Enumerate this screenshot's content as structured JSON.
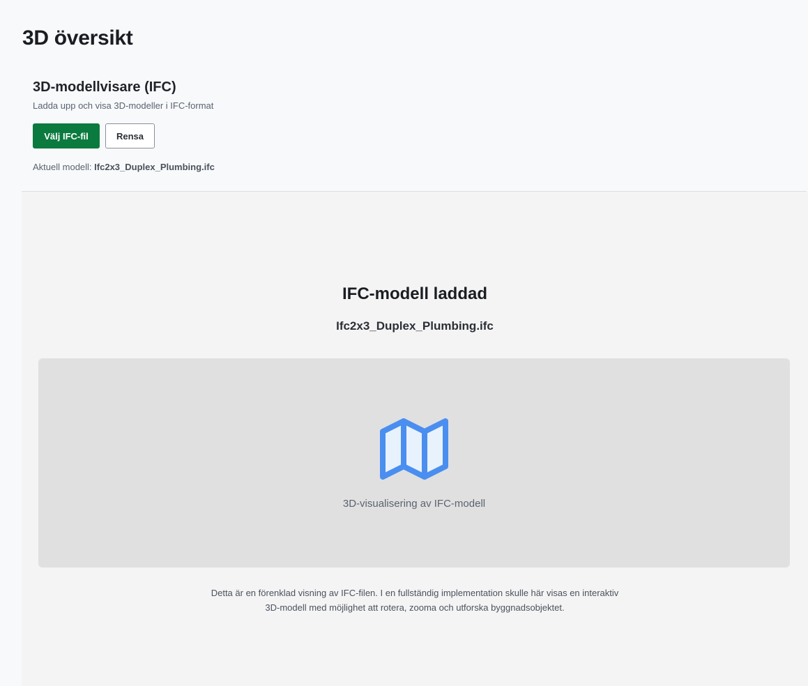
{
  "page": {
    "title": "3D översikt"
  },
  "viewer": {
    "title": "3D-modellvisare (IFC)",
    "subtitle": "Ladda upp och visa 3D-modeller i IFC-format",
    "select_button": "Välj IFC-fil",
    "clear_button": "Rensa",
    "current_model_label": "Aktuell modell:",
    "current_model_value": "Ifc2x3_Duplex_Plumbing.ifc"
  },
  "preview": {
    "heading": "IFC-modell laddad",
    "filename": "Ifc2x3_Duplex_Plumbing.ifc",
    "icon": "map-icon",
    "caption": "3D-visualisering av IFC-modell",
    "note": "Detta är en förenklad visning av IFC-filen. I en fullständig implementation skulle här visas en interaktiv 3D-modell med möjlighet att rotera, zooma och utforska byggnadsobjektet."
  },
  "colors": {
    "primary_button": "#0b7a3e",
    "icon_stroke": "#4a8ef0",
    "icon_fill": "#e8f2fd",
    "canvas_background": "#e0e0e0"
  }
}
